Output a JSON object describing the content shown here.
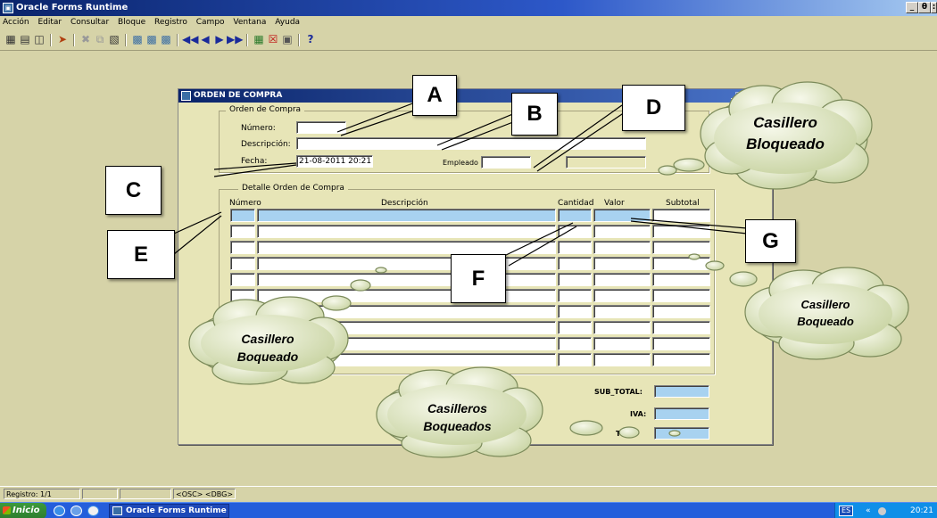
{
  "window": {
    "title": "Oracle Forms Runtime",
    "controls": [
      "_",
      "θ",
      ":"
    ]
  },
  "menu": [
    "Acción",
    "Editar",
    "Consultar",
    "Bloque",
    "Registro",
    "Campo",
    "Ventana",
    "Ayuda"
  ],
  "toolbar": {
    "help_label": "?"
  },
  "form": {
    "title": "ORDEN DE COMPRA",
    "controls": "_□|x|",
    "header_section": "Orden de Compra",
    "numero_label": "Número:",
    "descripcion_label": "Descripción:",
    "fecha_label": "Fecha:",
    "fecha_value": "21-08-2011 20:21",
    "empleado_label": "Empleado",
    "detail_section": "Detalle Orden de Compra",
    "columns": {
      "numero": "Número",
      "descripcion": "Descripción",
      "cantidad": "Cantidad",
      "valor": "Valor",
      "subtotal": "Subtotal"
    },
    "totals": {
      "subtotal_label": "SUB_TOTAL:",
      "iva_label": "IVA:",
      "total_label": "TO…"
    }
  },
  "callouts": {
    "a": "A",
    "b": "B",
    "c": "C",
    "d": "D",
    "e": "E",
    "f": "F",
    "g": "G"
  },
  "clouds": {
    "top_right": {
      "line1": "Casillero",
      "line2": "Bloqueado"
    },
    "right": {
      "line1": "Casillero",
      "line2": "Boqueado"
    },
    "left": {
      "line1": "Casillero",
      "line2": "Boqueado"
    },
    "bottom": {
      "line1": "Casilleros",
      "line2": "Boqueados"
    }
  },
  "statusbar": {
    "record": "Registro: 1/1",
    "mode": "<OSC> <DBG>"
  },
  "taskbar": {
    "start": "Inicio",
    "item": "Oracle Forms Runtime",
    "lang": "ES",
    "clock": "20:21",
    "tray_arrows": "«"
  },
  "colors": {
    "background": "#d6d3a8",
    "form_bg": "#e7e5b7",
    "highlight_field": "#a8d2f0",
    "titlebar": "#0a246a"
  }
}
